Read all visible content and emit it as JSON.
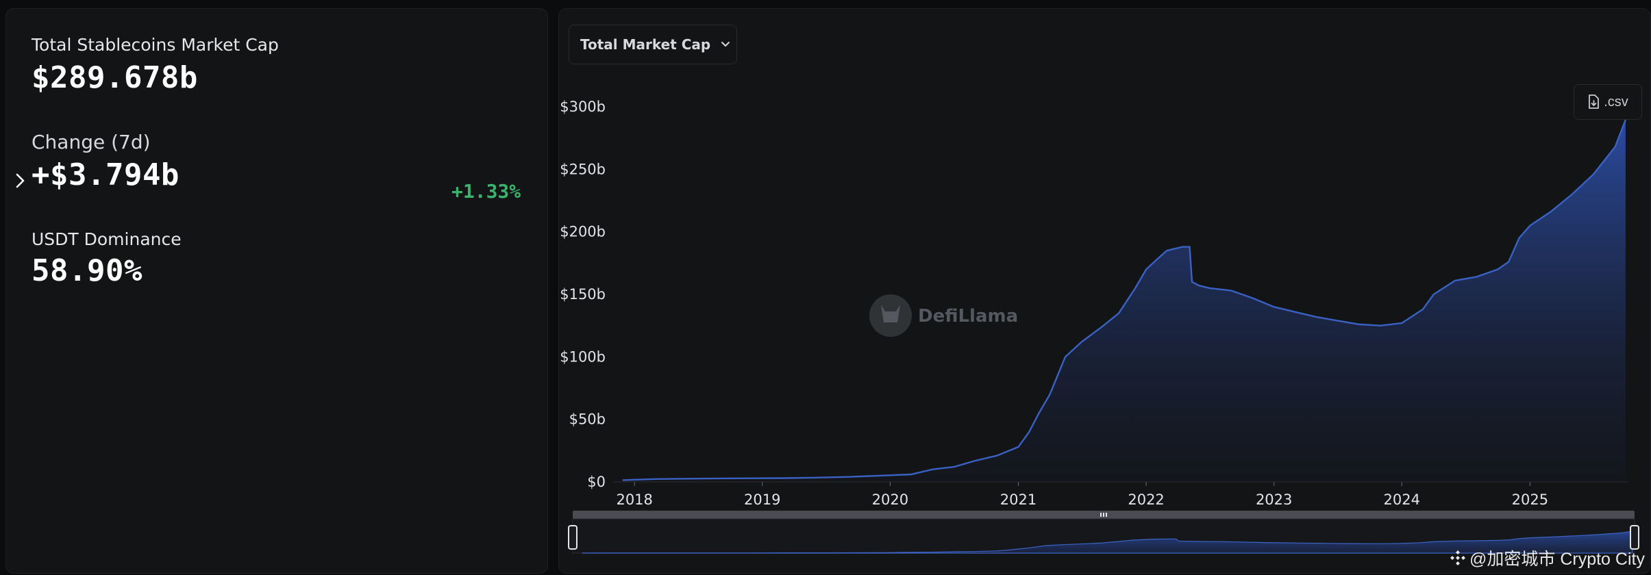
{
  "stats": {
    "total_label": "Total Stablecoins Market Cap",
    "total_value": "$289.678b",
    "change_label": "Change (7d)",
    "change_value": "+$3.794b",
    "change_percent": "+1.33%",
    "dominance_label": "USDT Dominance",
    "dominance_value": "58.90%"
  },
  "controls": {
    "dropdown_label": "Total Market Cap",
    "csv_label": ".csv"
  },
  "watermark": "DefiLlama",
  "credit": "@加密城市 Crypto City",
  "colors": {
    "line": "#3a62c4",
    "positive": "#3bb36f",
    "panel": "#131416"
  },
  "chart_data": {
    "type": "area",
    "x": [
      "2017-11-28",
      "2018-03-01",
      "2018-06-01",
      "2018-09-01",
      "2018-12-01",
      "2019-03-01",
      "2019-06-01",
      "2019-09-01",
      "2019-12-01",
      "2020-03-01",
      "2020-05-01",
      "2020-07-01",
      "2020-09-01",
      "2020-11-01",
      "2021-01-01",
      "2021-02-01",
      "2021-03-01",
      "2021-04-01",
      "2021-05-15",
      "2021-07-01",
      "2021-09-01",
      "2021-10-15",
      "2021-12-01",
      "2022-01-01",
      "2022-02-01",
      "2022-03-01",
      "2022-04-15",
      "2022-05-05",
      "2022-05-12",
      "2022-06-01",
      "2022-07-01",
      "2022-09-01",
      "2022-11-01",
      "2023-01-01",
      "2023-03-01",
      "2023-05-01",
      "2023-07-01",
      "2023-09-01",
      "2023-11-01",
      "2024-01-01",
      "2024-03-01",
      "2024-04-01",
      "2024-06-01",
      "2024-08-01",
      "2024-10-01",
      "2024-11-01",
      "2024-12-01",
      "2025-01-01",
      "2025-03-01",
      "2025-05-01",
      "2025-07-01",
      "2025-09-01",
      "2025-10-01"
    ],
    "y": [
      1.4,
      2.3,
      2.6,
      2.8,
      2.9,
      3.0,
      3.4,
      4.0,
      5.0,
      6.0,
      10.0,
      12.0,
      17.0,
      21.0,
      28.0,
      40.0,
      55.0,
      70.0,
      100.0,
      112.0,
      125.0,
      135.0,
      155.0,
      170.0,
      178.0,
      185.0,
      188.0,
      188.0,
      160.0,
      157.0,
      155.0,
      153.0,
      147.0,
      140.0,
      136.0,
      132.0,
      129.0,
      126.0,
      125.0,
      127.0,
      138.0,
      150.0,
      161.0,
      164.0,
      170.0,
      176.0,
      195.0,
      205.0,
      216.0,
      230.0,
      246.0,
      268.0,
      289.7
    ],
    "xticks": [
      "2018",
      "2019",
      "2020",
      "2021",
      "2022",
      "2023",
      "2024",
      "2025"
    ],
    "yticks": [
      "$0",
      "$50b",
      "$100b",
      "$150b",
      "$200b",
      "$250b",
      "$300b"
    ],
    "ylim": [
      0,
      300
    ],
    "xlim": [
      "2017-11-01",
      "2025-10-07"
    ],
    "grid": false,
    "legend": "none"
  }
}
